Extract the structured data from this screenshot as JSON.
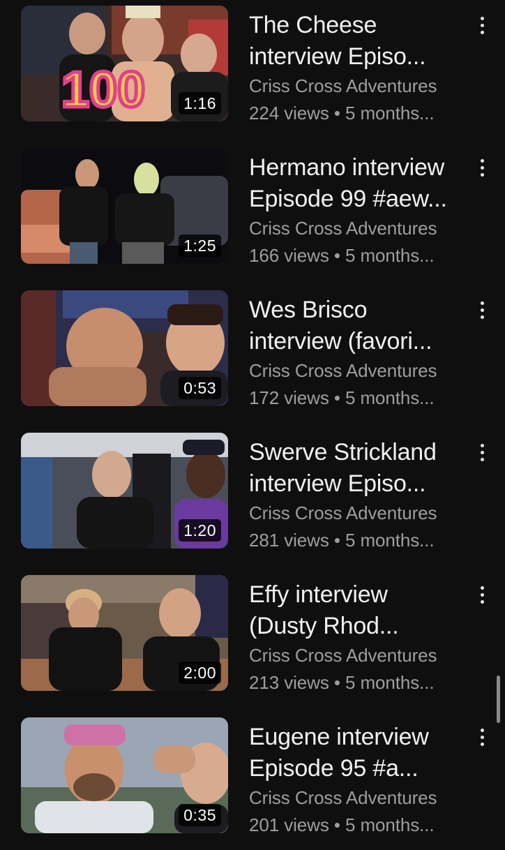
{
  "videos": [
    {
      "title": "The Cheese\ninterview Episo...",
      "channel": "Criss Cross Adventures",
      "stats": "224 views • 5 months...",
      "duration": "1:16",
      "thumbnail_badge": "100"
    },
    {
      "title": "Hermano interview\nEpisode 99 #aew...",
      "channel": "Criss Cross Adventures",
      "stats": "166 views • 5 months...",
      "duration": "1:25"
    },
    {
      "title": "Wes Brisco\ninterview (favori...",
      "channel": "Criss Cross Adventures",
      "stats": "172 views • 5 months...",
      "duration": "0:53"
    },
    {
      "title": "Swerve Strickland\ninterview Episo...",
      "channel": "Criss Cross Adventures",
      "stats": "281 views • 5 months...",
      "duration": "1:20"
    },
    {
      "title": "Effy interview\n(Dusty Rhod...",
      "channel": "Criss Cross Adventures",
      "stats": "213 views • 5 months...",
      "duration": "2:00"
    },
    {
      "title": "Eugene interview\nEpisode 95 #a...",
      "channel": "Criss Cross Adventures",
      "stats": "201 views • 5 months...",
      "duration": "0:35"
    }
  ],
  "colors": {
    "background": "#0f0f0f",
    "title": "#f1f1f1",
    "meta": "#9e9e9e"
  }
}
